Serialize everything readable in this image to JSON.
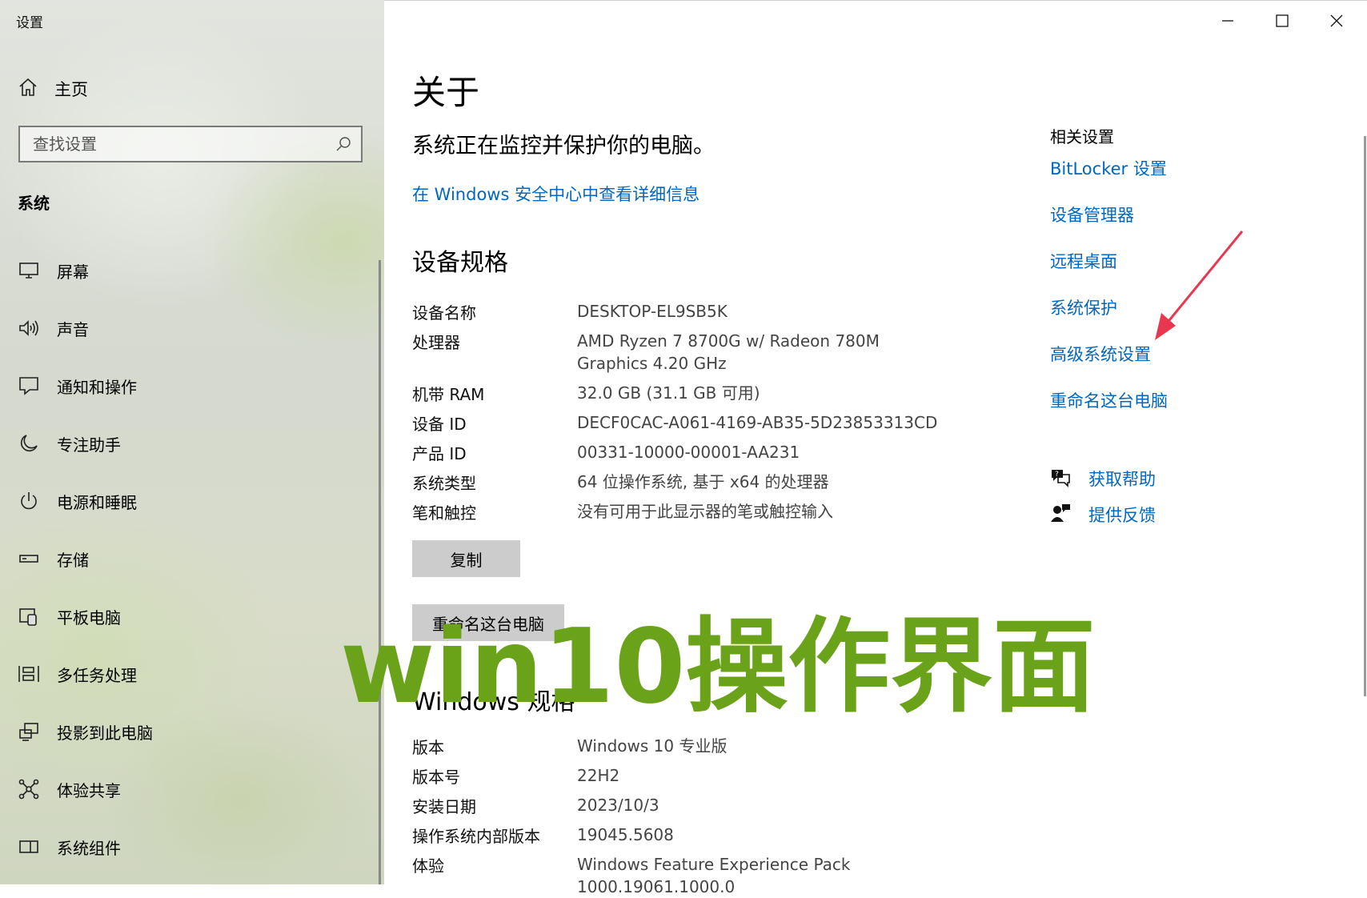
{
  "window": {
    "title": "设置"
  },
  "sidebar": {
    "home_label": "主页",
    "search_placeholder": "查找设置",
    "section_title": "系统",
    "items": [
      {
        "label": "屏幕",
        "icon": "monitor-icon"
      },
      {
        "label": "声音",
        "icon": "speaker-icon"
      },
      {
        "label": "通知和操作",
        "icon": "notification-icon"
      },
      {
        "label": "专注助手",
        "icon": "moon-icon"
      },
      {
        "label": "电源和睡眠",
        "icon": "power-icon"
      },
      {
        "label": "存储",
        "icon": "storage-icon"
      },
      {
        "label": "平板电脑",
        "icon": "tablet-icon"
      },
      {
        "label": "多任务处理",
        "icon": "multitask-icon"
      },
      {
        "label": "投影到此电脑",
        "icon": "project-icon"
      },
      {
        "label": "体验共享",
        "icon": "share-icon"
      },
      {
        "label": "系统组件",
        "icon": "components-icon"
      }
    ]
  },
  "main": {
    "title": "关于",
    "status": "系统正在监控并保护你的电脑。",
    "security_link": "在 Windows 安全中心中查看详细信息",
    "device_specs": {
      "heading": "设备规格",
      "rows": [
        {
          "key": "设备名称",
          "value": "DESKTOP-EL9SB5K"
        },
        {
          "key": "处理器",
          "value": "AMD Ryzen 7 8700G w/ Radeon 780M Graphics 4.20 GHz"
        },
        {
          "key": "机带 RAM",
          "value": "32.0 GB (31.1 GB 可用)"
        },
        {
          "key": "设备 ID",
          "value": "DECF0CAC-A061-4169-AB35-5D23853313CD"
        },
        {
          "key": "产品 ID",
          "value": "00331-10000-00001-AA231"
        },
        {
          "key": "系统类型",
          "value": "64 位操作系统, 基于 x64 的处理器"
        },
        {
          "key": "笔和触控",
          "value": "没有可用于此显示器的笔或触控输入"
        }
      ],
      "copy_button": "复制",
      "rename_button": "重命名这台电脑"
    },
    "windows_specs": {
      "heading": "Windows 规格",
      "rows": [
        {
          "key": "版本",
          "value": "Windows 10 专业版"
        },
        {
          "key": "版本号",
          "value": "22H2"
        },
        {
          "key": "安装日期",
          "value": "2023/10/3"
        },
        {
          "key": "操作系统内部版本",
          "value": "19045.5608"
        },
        {
          "key": "体验",
          "value": "Windows Feature Experience Pack 1000.19061.1000.0"
        }
      ]
    }
  },
  "related": {
    "title": "相关设置",
    "links": [
      "BitLocker 设置",
      "设备管理器",
      "远程桌面",
      "系统保护",
      "高级系统设置",
      "重命名这台电脑"
    ],
    "help": "获取帮助",
    "feedback": "提供反馈"
  },
  "watermark": "win10操作界面",
  "colors": {
    "link": "#0067c0",
    "watermark": "#6aa21a",
    "arrow": "#e8384f",
    "button": "#cccccc"
  }
}
